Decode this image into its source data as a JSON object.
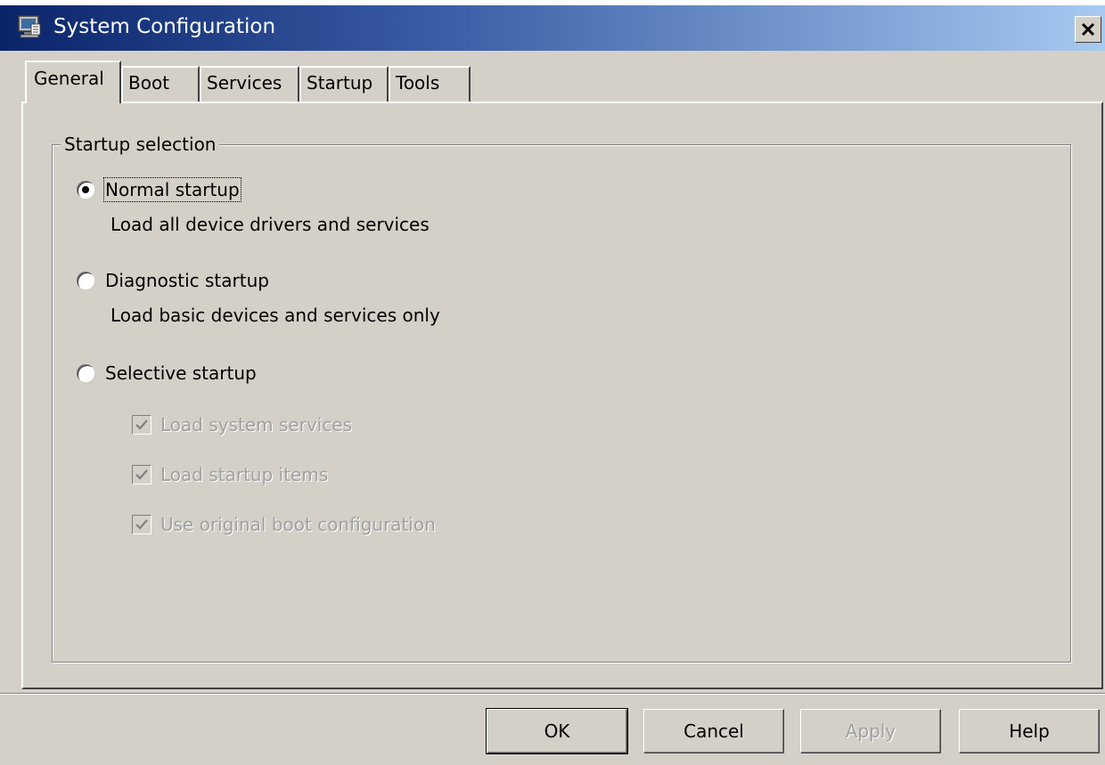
{
  "window": {
    "title": "System Configuration"
  },
  "tabs": [
    {
      "label": "General",
      "active": true
    },
    {
      "label": "Boot",
      "active": false
    },
    {
      "label": "Services",
      "active": false
    },
    {
      "label": "Startup",
      "active": false
    },
    {
      "label": "Tools",
      "active": false
    }
  ],
  "startup_selection": {
    "group_label": "Startup selection",
    "normal": {
      "label": "Normal startup",
      "description": "Load all device drivers and services",
      "checked": true
    },
    "diagnostic": {
      "label": "Diagnostic startup",
      "description": "Load basic devices and services only",
      "checked": false
    },
    "selective": {
      "label": "Selective startup",
      "checked": false,
      "options": [
        {
          "label": "Load system services",
          "checked": true,
          "enabled": false
        },
        {
          "label": "Load startup items",
          "checked": true,
          "enabled": false
        },
        {
          "label": "Use original boot configuration",
          "checked": true,
          "enabled": false
        }
      ]
    }
  },
  "buttons": {
    "ok": "OK",
    "cancel": "Cancel",
    "apply": "Apply",
    "help": "Help"
  },
  "icons": {
    "app": "msconfig-computer-icon",
    "close": "close-icon"
  }
}
